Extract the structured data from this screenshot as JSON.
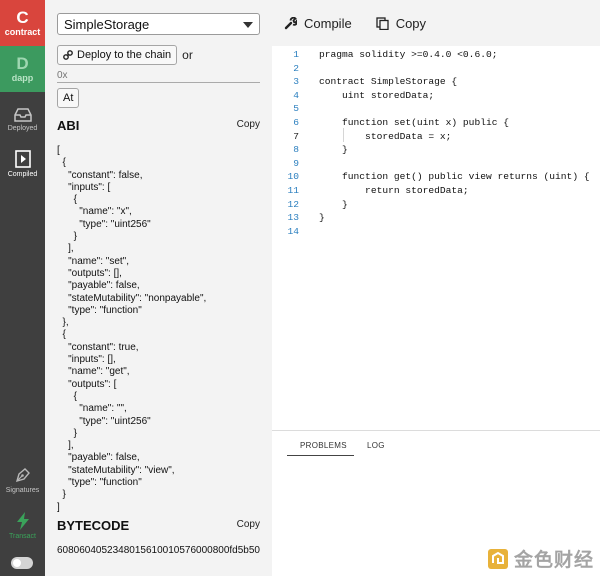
{
  "rail": {
    "brand_top": {
      "letter": "C",
      "word": "contract"
    },
    "brand_second": {
      "letter": "D",
      "word": "dapp"
    },
    "items": [
      {
        "label": "Deployed",
        "icon": "inbox-icon"
      },
      {
        "label": "Compiled",
        "icon": "play-file-icon"
      },
      {
        "label": "Signatures",
        "icon": "pen-icon"
      },
      {
        "label": "Transact",
        "icon": "lightning-icon"
      }
    ]
  },
  "panel": {
    "selected_contract": "SimpleStorage",
    "deploy_label": "Deploy to the chain",
    "or_label": "or",
    "address_placeholder": "0x",
    "at_label": "At",
    "abi_title": "ABI",
    "abi_copy": "Copy",
    "abi_text": "[\n  {\n    \"constant\": false,\n    \"inputs\": [\n      {\n        \"name\": \"x\",\n        \"type\": \"uint256\"\n      }\n    ],\n    \"name\": \"set\",\n    \"outputs\": [],\n    \"payable\": false,\n    \"stateMutability\": \"nonpayable\",\n    \"type\": \"function\"\n  },\n  {\n    \"constant\": true,\n    \"inputs\": [],\n    \"name\": \"get\",\n    \"outputs\": [\n      {\n        \"name\": \"\",\n        \"type\": \"uint256\"\n      }\n    ],\n    \"payable\": false,\n    \"stateMutability\": \"view\",\n    \"type\": \"function\"\n  }\n]",
    "bytecode_title": "BYTECODE",
    "bytecode_copy": "Copy",
    "bytecode_value": "6080604052348015610010576000800fd5b50"
  },
  "toolbar": {
    "compile_label": "Compile",
    "copy_label": "Copy"
  },
  "editor": {
    "current_line": 7,
    "lines": [
      {
        "num": "1",
        "text": "pragma solidity >=0.4.0 <0.6.0;"
      },
      {
        "num": "2",
        "text": ""
      },
      {
        "num": "3",
        "text": "contract SimpleStorage {"
      },
      {
        "num": "4",
        "text": "    uint storedData;"
      },
      {
        "num": "5",
        "text": ""
      },
      {
        "num": "6",
        "text": "    function set(uint x) public {"
      },
      {
        "num": "7",
        "text": "        storedData = x;"
      },
      {
        "num": "8",
        "text": "    }"
      },
      {
        "num": "9",
        "text": ""
      },
      {
        "num": "10",
        "text": "    function get() public view returns (uint) {"
      },
      {
        "num": "11",
        "text": "        return storedData;"
      },
      {
        "num": "12",
        "text": "    }"
      },
      {
        "num": "13",
        "text": "}"
      },
      {
        "num": "14",
        "text": ""
      }
    ]
  },
  "bottom_panel": {
    "tabs": [
      "PROBLEMS",
      "LOG"
    ],
    "active_tab": "PROBLEMS"
  },
  "watermark": {
    "text": "金色财经"
  },
  "colors": {
    "contract_red": "#d9453d",
    "dapp_green": "#3c9a5f",
    "rail_bg": "#3f3f3f",
    "line_number_blue": "#2b7fbf"
  }
}
